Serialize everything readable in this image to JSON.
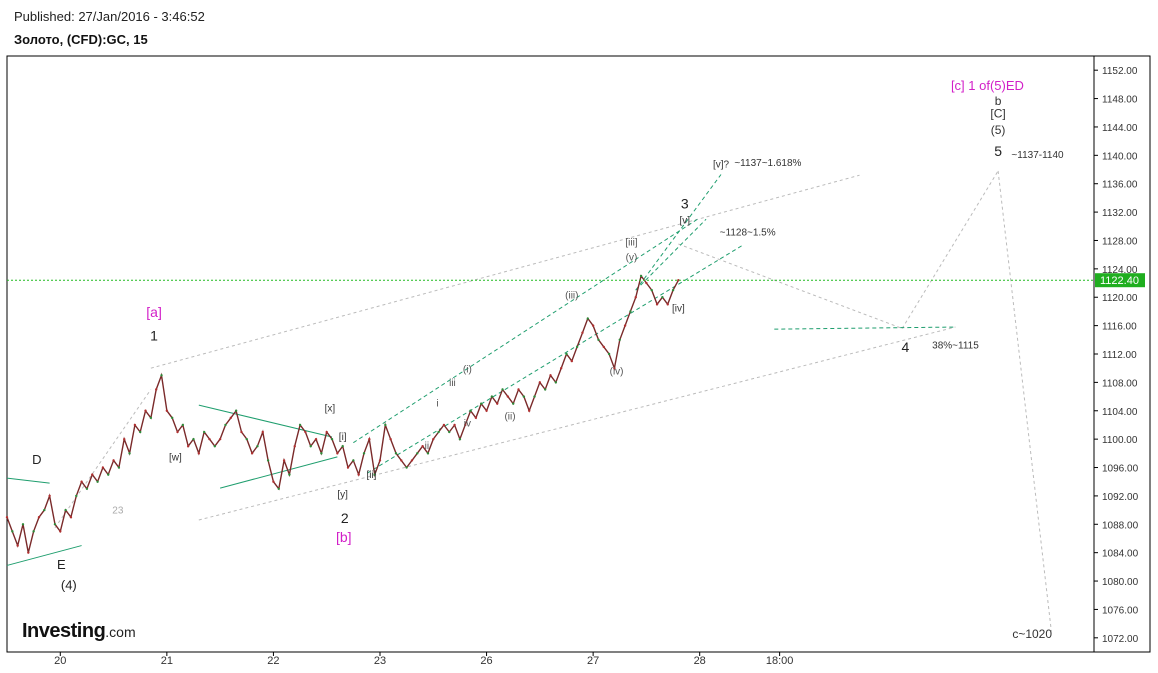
{
  "header": {
    "published": "Published: 27/Jan/2016 - 3:46:52",
    "symbol": "Золото, (CFD):GC, 15"
  },
  "branding": {
    "logo_main": "Investing",
    "logo_suffix": ".com"
  },
  "chart_data": {
    "type": "line",
    "title": "",
    "xlabel": "",
    "ylabel": "",
    "ylim": [
      1070,
      1154
    ],
    "y_ticks": [
      1072,
      1076,
      1080,
      1084,
      1088,
      1092,
      1096,
      1100,
      1104,
      1108,
      1112,
      1116,
      1120,
      1124,
      1128,
      1132,
      1136,
      1140,
      1144,
      1148,
      1152
    ],
    "y_tick_labels": [
      "1072.00",
      "1076.00",
      "1080.00",
      "1084.00",
      "1088.00",
      "1092.00",
      "1096.00",
      "1100.00",
      "1104.00",
      "1108.00",
      "1112.00",
      "1116.00",
      "1120.00",
      "1124.00",
      "1128.00",
      "1132.00",
      "1136.00",
      "1140.00",
      "1144.00",
      "1148.00",
      "1152.00"
    ],
    "x_ticks": [
      {
        "label": "20",
        "t": 0.5
      },
      {
        "label": "21",
        "t": 1.5
      },
      {
        "label": "22",
        "t": 2.5
      },
      {
        "label": "23",
        "t": 3.5
      },
      {
        "label": "26",
        "t": 4.5
      },
      {
        "label": "27",
        "t": 5.5
      },
      {
        "label": "28",
        "t": 6.5
      },
      {
        "label": "18:00",
        "t": 7.25
      }
    ],
    "current_price": 1122.4,
    "current_price_label": "1122.40",
    "price_path": [
      [
        0,
        1089
      ],
      [
        0.05,
        1087
      ],
      [
        0.1,
        1085
      ],
      [
        0.15,
        1088
      ],
      [
        0.2,
        1084
      ],
      [
        0.25,
        1087
      ],
      [
        0.3,
        1089
      ],
      [
        0.35,
        1090
      ],
      [
        0.4,
        1092
      ],
      [
        0.45,
        1088
      ],
      [
        0.5,
        1087
      ],
      [
        0.55,
        1090
      ],
      [
        0.6,
        1089
      ],
      [
        0.65,
        1092
      ],
      [
        0.7,
        1094
      ],
      [
        0.75,
        1093
      ],
      [
        0.8,
        1095
      ],
      [
        0.85,
        1094
      ],
      [
        0.9,
        1096
      ],
      [
        0.95,
        1095
      ],
      [
        1.0,
        1097
      ],
      [
        1.05,
        1096
      ],
      [
        1.1,
        1100
      ],
      [
        1.15,
        1098
      ],
      [
        1.2,
        1102
      ],
      [
        1.25,
        1101
      ],
      [
        1.3,
        1104
      ],
      [
        1.35,
        1103
      ],
      [
        1.4,
        1107
      ],
      [
        1.45,
        1109
      ],
      [
        1.5,
        1104
      ],
      [
        1.55,
        1103
      ],
      [
        1.6,
        1101
      ],
      [
        1.65,
        1102
      ],
      [
        1.7,
        1099
      ],
      [
        1.75,
        1100
      ],
      [
        1.8,
        1098
      ],
      [
        1.85,
        1101
      ],
      [
        1.9,
        1100
      ],
      [
        1.95,
        1099
      ],
      [
        2.0,
        1100
      ],
      [
        2.05,
        1102
      ],
      [
        2.1,
        1103
      ],
      [
        2.15,
        1104
      ],
      [
        2.2,
        1101
      ],
      [
        2.25,
        1100
      ],
      [
        2.3,
        1098
      ],
      [
        2.35,
        1099
      ],
      [
        2.4,
        1101
      ],
      [
        2.45,
        1097
      ],
      [
        2.5,
        1094
      ],
      [
        2.55,
        1093
      ],
      [
        2.6,
        1097
      ],
      [
        2.65,
        1095
      ],
      [
        2.7,
        1099
      ],
      [
        2.75,
        1102
      ],
      [
        2.8,
        1101
      ],
      [
        2.85,
        1099
      ],
      [
        2.9,
        1100
      ],
      [
        2.95,
        1098
      ],
      [
        3.0,
        1101
      ],
      [
        3.05,
        1100
      ],
      [
        3.1,
        1098
      ],
      [
        3.15,
        1099
      ],
      [
        3.2,
        1096
      ],
      [
        3.25,
        1097
      ],
      [
        3.3,
        1095
      ],
      [
        3.35,
        1098
      ],
      [
        3.4,
        1100
      ],
      [
        3.45,
        1095
      ],
      [
        3.5,
        1097
      ],
      [
        3.55,
        1102
      ],
      [
        3.6,
        1100
      ],
      [
        3.65,
        1098
      ],
      [
        3.7,
        1097
      ],
      [
        3.75,
        1096
      ],
      [
        3.8,
        1097
      ],
      [
        3.85,
        1098
      ],
      [
        3.9,
        1099
      ],
      [
        3.95,
        1098
      ],
      [
        4.0,
        1100
      ],
      [
        4.05,
        1101
      ],
      [
        4.1,
        1102
      ],
      [
        4.15,
        1101
      ],
      [
        4.2,
        1102
      ],
      [
        4.25,
        1100
      ],
      [
        4.3,
        1102
      ],
      [
        4.35,
        1104
      ],
      [
        4.4,
        1103
      ],
      [
        4.45,
        1105
      ],
      [
        4.5,
        1104
      ],
      [
        4.55,
        1106
      ],
      [
        4.6,
        1105
      ],
      [
        4.65,
        1107
      ],
      [
        4.7,
        1106
      ],
      [
        4.75,
        1105
      ],
      [
        4.8,
        1107
      ],
      [
        4.85,
        1106
      ],
      [
        4.9,
        1104
      ],
      [
        4.95,
        1106
      ],
      [
        5.0,
        1108
      ],
      [
        5.05,
        1107
      ],
      [
        5.1,
        1109
      ],
      [
        5.15,
        1108
      ],
      [
        5.2,
        1110
      ],
      [
        5.25,
        1112
      ],
      [
        5.3,
        1111
      ],
      [
        5.35,
        1113
      ],
      [
        5.4,
        1115
      ],
      [
        5.45,
        1117
      ],
      [
        5.5,
        1116
      ],
      [
        5.55,
        1114
      ],
      [
        5.6,
        1113
      ],
      [
        5.65,
        1112
      ],
      [
        5.7,
        1110
      ],
      [
        5.75,
        1114
      ],
      [
        5.8,
        1116
      ],
      [
        5.85,
        1118
      ],
      [
        5.9,
        1120
      ],
      [
        5.95,
        1123
      ],
      [
        6.0,
        1122
      ],
      [
        6.05,
        1121
      ],
      [
        6.1,
        1119
      ],
      [
        6.15,
        1120
      ],
      [
        6.2,
        1119
      ],
      [
        6.25,
        1121
      ],
      [
        6.3,
        1122.4
      ]
    ],
    "markers": [
      {
        "text": "[c] 1 of(5)ED",
        "t": 9.2,
        "y": 1149.2,
        "color": "#d21fc8",
        "size": 13
      },
      {
        "text": "b",
        "t": 9.3,
        "y": 1147.1,
        "color": "#333333",
        "size": 12
      },
      {
        "text": "[C]",
        "t": 9.3,
        "y": 1145.3,
        "color": "#333333",
        "size": 12
      },
      {
        "text": "(5)",
        "t": 9.3,
        "y": 1143.0,
        "color": "#333333",
        "size": 12
      },
      {
        "text": "5",
        "t": 9.3,
        "y": 1139.9,
        "color": "#222222",
        "size": 14
      },
      {
        "text": "~1137-1140",
        "t": 9.67,
        "y": 1139.6,
        "color": "#333333",
        "size": 10
      },
      {
        "text": "[v]?",
        "t": 6.7,
        "y": 1138.3,
        "color": "#333333",
        "size": 10
      },
      {
        "text": "~1137~1.618%",
        "t": 7.14,
        "y": 1138.5,
        "color": "#333333",
        "size": 10
      },
      {
        "text": "3",
        "t": 6.36,
        "y": 1132.5,
        "color": "#222222",
        "size": 14
      },
      {
        "text": "[v]",
        "t": 6.36,
        "y": 1130.4,
        "color": "#333333",
        "size": 10
      },
      {
        "text": "~1128~1.5%",
        "t": 6.95,
        "y": 1128.7,
        "color": "#333333",
        "size": 10
      },
      {
        "text": "[iii]",
        "t": 5.86,
        "y": 1127.3,
        "color": "#555555",
        "size": 10
      },
      {
        "text": "(v)",
        "t": 5.86,
        "y": 1125.2,
        "color": "#555555",
        "size": 10
      },
      {
        "text": "[iv]",
        "t": 6.3,
        "y": 1118.0,
        "color": "#333333",
        "size": 10
      },
      {
        "text": "(iii)",
        "t": 5.3,
        "y": 1119.8,
        "color": "#555555",
        "size": 10
      },
      {
        "text": "4",
        "t": 8.43,
        "y": 1112.3,
        "color": "#222222",
        "size": 14
      },
      {
        "text": "38%~1115",
        "t": 8.9,
        "y": 1112.8,
        "color": "#333333",
        "size": 10
      },
      {
        "text": "(iv)",
        "t": 5.72,
        "y": 1109.1,
        "color": "#555555",
        "size": 10
      },
      {
        "text": "(i)",
        "t": 4.32,
        "y": 1109.4,
        "color": "#555555",
        "size": 10
      },
      {
        "text": "iii",
        "t": 4.18,
        "y": 1107.5,
        "color": "#555555",
        "size": 10
      },
      {
        "text": "i",
        "t": 4.04,
        "y": 1104.6,
        "color": "#555555",
        "size": 10
      },
      {
        "text": "iv",
        "t": 4.32,
        "y": 1101.8,
        "color": "#555555",
        "size": 10
      },
      {
        "text": "(ii)",
        "t": 4.72,
        "y": 1102.8,
        "color": "#555555",
        "size": 10
      },
      {
        "text": "ii",
        "t": 3.94,
        "y": 1098.6,
        "color": "#555555",
        "size": 10
      },
      {
        "text": "[i]",
        "t": 3.15,
        "y": 1099.9,
        "color": "#333333",
        "size": 10
      },
      {
        "text": "[x]",
        "t": 3.03,
        "y": 1103.9,
        "color": "#333333",
        "size": 10
      },
      {
        "text": "[ii]",
        "t": 3.42,
        "y": 1094.5,
        "color": "#333333",
        "size": 10
      },
      {
        "text": "[y]",
        "t": 3.15,
        "y": 1091.8,
        "color": "#333333",
        "size": 10
      },
      {
        "text": "2",
        "t": 3.17,
        "y": 1088.2,
        "color": "#222222",
        "size": 14
      },
      {
        "text": "[b]",
        "t": 3.16,
        "y": 1085.5,
        "color": "#d21fc8",
        "size": 14
      },
      {
        "text": "[a]",
        "t": 1.38,
        "y": 1117.2,
        "color": "#d21fc8",
        "size": 14
      },
      {
        "text": "1",
        "t": 1.38,
        "y": 1113.9,
        "color": "#222222",
        "size": 14
      },
      {
        "text": "[w]",
        "t": 1.58,
        "y": 1097.0,
        "color": "#333333",
        "size": 10
      },
      {
        "text": "D",
        "t": 0.28,
        "y": 1096.5,
        "color": "#222222",
        "size": 13
      },
      {
        "text": "23",
        "t": 1.04,
        "y": 1089.5,
        "color": "#aaaaaa",
        "size": 10
      },
      {
        "text": "E",
        "t": 0.51,
        "y": 1081.7,
        "color": "#222222",
        "size": 13
      },
      {
        "text": "(4)",
        "t": 0.58,
        "y": 1078.8,
        "color": "#222222",
        "size": 13
      },
      {
        "text": "c~1020",
        "t": 9.62,
        "y": 1072.0,
        "color": "#333333",
        "size": 12
      }
    ],
    "green_lines": [
      [
        [
          0,
          1094.5
        ],
        [
          0.4,
          1093.8
        ]
      ],
      [
        [
          0,
          1082.2
        ],
        [
          0.7,
          1085
        ]
      ],
      [
        [
          1.8,
          1104.8
        ],
        [
          3.05,
          1100.3
        ]
      ],
      [
        [
          2.0,
          1093.1
        ],
        [
          3.1,
          1097.5
        ]
      ],
      [
        [
          3.25,
          1099.5
        ],
        [
          6.5,
          1131.2
        ]
      ],
      [
        [
          3.38,
          1095.2
        ],
        [
          6.9,
          1127.3
        ]
      ],
      [
        [
          5.9,
          1121.0
        ],
        [
          6.7,
          1137.3
        ]
      ],
      [
        [
          5.9,
          1121.0
        ],
        [
          6.56,
          1131.0
        ]
      ],
      [
        [
          7.2,
          1115.5
        ],
        [
          8.9,
          1115.8
        ]
      ]
    ],
    "grey_dashed_lines": [
      [
        [
          1.35,
          1110
        ],
        [
          8.0,
          1137.2
        ]
      ],
      [
        [
          1.8,
          1088.6
        ],
        [
          8.9,
          1115.8
        ]
      ],
      [
        [
          6.3,
          1127.5
        ],
        [
          8.4,
          1115.6
        ]
      ],
      [
        [
          8.4,
          1115.6
        ],
        [
          9.3,
          1137.8
        ]
      ],
      [
        [
          9.3,
          1137.8
        ],
        [
          9.8,
          1072.9
        ]
      ],
      [
        [
          0.45,
          1087.5
        ],
        [
          1.35,
          1107
        ]
      ]
    ]
  }
}
